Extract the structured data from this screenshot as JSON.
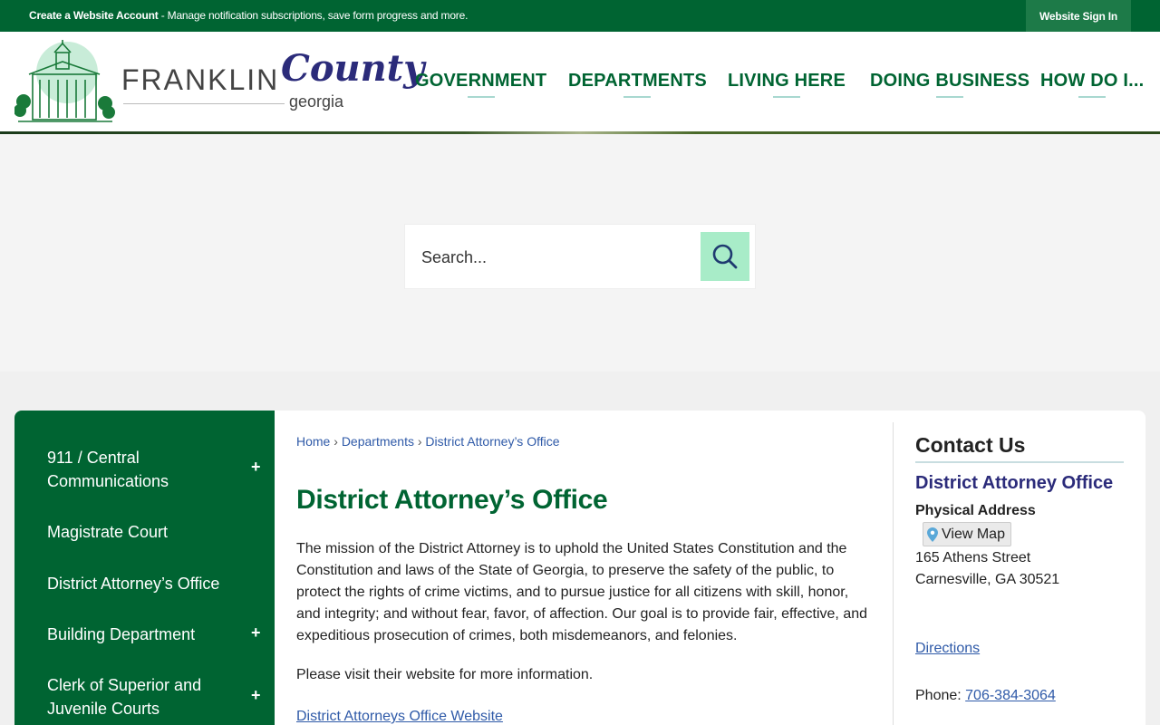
{
  "topbar": {
    "account_bold": "Create a Website Account",
    "account_rest": " - Manage notification subscriptions, save form progress and more.",
    "signin": "Website Sign In"
  },
  "logo": {
    "franklin": "FRANKLIN",
    "county": "County",
    "georgia": "georgia"
  },
  "nav": {
    "items": [
      "GOVERNMENT",
      "DEPARTMENTS",
      "LIVING HERE",
      "DOING BUSINESS",
      "HOW DO I..."
    ]
  },
  "search": {
    "placeholder": "Search..."
  },
  "sidebar": {
    "items": [
      {
        "label_line1": "911 / Central",
        "label_line2": "Communications",
        "expandable": true
      },
      {
        "label_line1": "Magistrate Court",
        "expandable": false
      },
      {
        "label_line1": "District Attorney’s Office",
        "expandable": false
      },
      {
        "label_line1": "Building Department",
        "expandable": true
      },
      {
        "label_line1": "Clerk of Superior and",
        "label_line2": "Juvenile Courts",
        "expandable": true
      }
    ],
    "plus": "+"
  },
  "breadcrumb": {
    "home": "Home",
    "sep": "›",
    "departments": "Departments",
    "current": "District Attorney’s Office"
  },
  "main": {
    "title": "District Attorney’s Office",
    "paragraph": "The mission of the District Attorney is to uphold the United States Constitution and the Constitution and laws of the State of Georgia, to preserve the safety of the public, to protect the rights of crime victims, and to pursue justice for all citizens with skill, honor, and integrity; and without fear, favor, of affection. Our goal is to provide fair, effective, and expeditious prosecution of crimes, both misdemeanors, and felonies.",
    "visit": "Please visit their website for more information.",
    "link": "District Attorneys Office Website"
  },
  "contact": {
    "title": "Contact Us",
    "org": "District Attorney Office",
    "address_label": "Physical Address",
    "view_map": "View Map",
    "street": "165 Athens Street",
    "city": "Carnesville, GA 30521",
    "directions": "Directions",
    "phone_label": "Phone: ",
    "phone": "706-384-3064"
  }
}
